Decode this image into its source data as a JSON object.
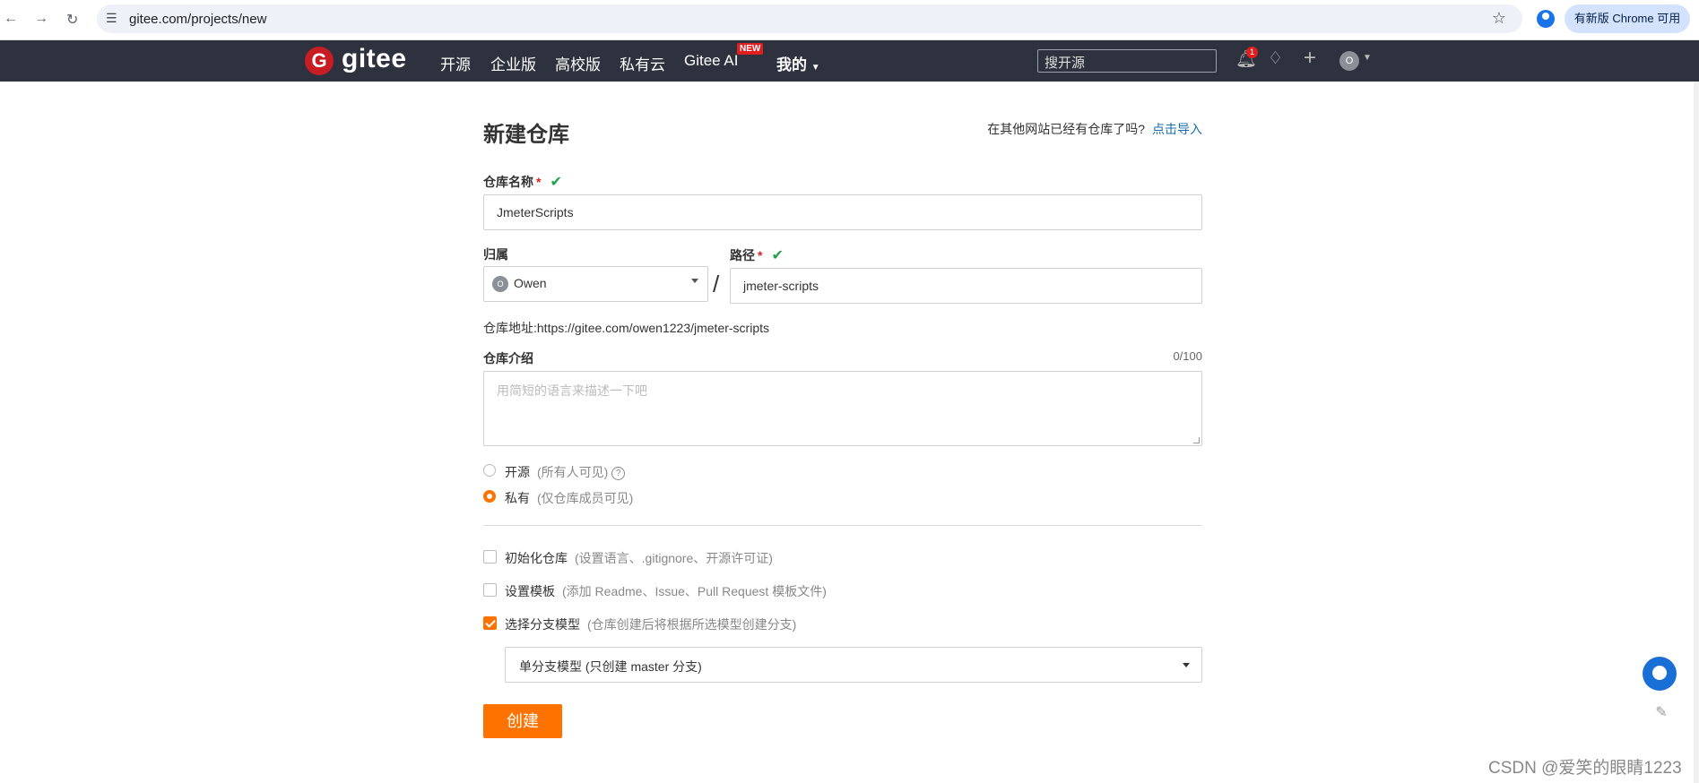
{
  "browser": {
    "url": "gitee.com/projects/new",
    "update_label": "有新版 Chrome 可用"
  },
  "navbar": {
    "logo_text": "gitee",
    "logo_mark": "G",
    "links": [
      "开源",
      "企业版",
      "高校版",
      "私有云",
      "Gitee AI"
    ],
    "new_badge": "NEW",
    "mine": "我的",
    "search_placeholder": "搜开源",
    "notification_count": "1",
    "user_initial": "O"
  },
  "form": {
    "title": "新建仓库",
    "import_question": "在其他网站已经有仓库了吗?",
    "import_link": "点击导入",
    "repo_name_label": "仓库名称",
    "repo_name_value": "JmeterScripts",
    "owner_label": "归属",
    "owner_initial": "O",
    "owner_name": "Owen",
    "path_label": "路径",
    "path_value": "jmeter-scripts",
    "slash": "/",
    "address": "仓库地址:https://gitee.com/owen1223/jmeter-scripts",
    "intro_label": "仓库介绍",
    "intro_counter": "0/100",
    "intro_placeholder": "用简短的语言来描述一下吧",
    "visibility": [
      {
        "label": "开源",
        "note": "(所有人可见)",
        "selected": false
      },
      {
        "label": "私有",
        "note": "(仅仓库成员可见)",
        "selected": true
      }
    ],
    "options": [
      {
        "label": "初始化仓库",
        "note": "(设置语言、.gitignore、开源许可证)",
        "checked": false
      },
      {
        "label": "设置模板",
        "note": "(添加 Readme、Issue、Pull Request 模板文件)",
        "checked": false
      },
      {
        "label": "选择分支模型",
        "note": "(仓库创建后将根据所选模型创建分支)",
        "checked": true
      }
    ],
    "branch_model": "单分支模型 (只创建 master 分支)",
    "create_label": "创建"
  },
  "watermark": "CSDN @爱笑的眼睛1223"
}
